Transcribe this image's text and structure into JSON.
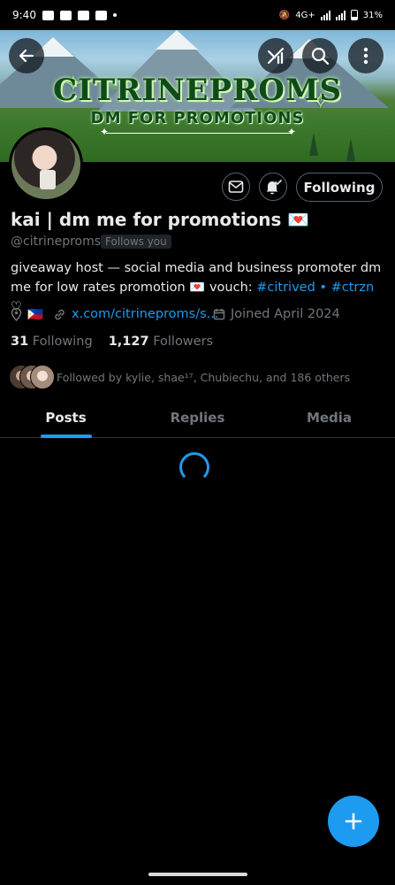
{
  "status_bar": {
    "time": "9:40",
    "network": "4G+",
    "battery": "31%"
  },
  "banner": {
    "title": "CITRINEPROMS",
    "subtitle": "DM FOR PROMOTIONS"
  },
  "profile": {
    "name": "kai | dm me for promotions 💌",
    "handle": "@citrineproms",
    "follows_you": "Follows you",
    "bio_text": "giveaway host — social media and business promoter dm me for low rates promotion 💌 vouch: ",
    "bio_tag1": "#citrived",
    "bio_sep": " • ",
    "bio_tag2": "#ctrzn",
    "bio_end": " ♡",
    "flag": "🇵🇭",
    "link": "x.com/citrineproms/s...",
    "joined": "Joined April 2024",
    "following_count": "31",
    "following_label": "Following",
    "followers_count": "1,127",
    "followers_label": "Followers",
    "followed_by": "Followed by kylie, shae¹⁷, Chubiechu, and 186 others"
  },
  "actions": {
    "follow_label": "Following"
  },
  "tabs": [
    {
      "label": "Posts"
    },
    {
      "label": "Replies"
    },
    {
      "label": "Media"
    }
  ],
  "colors": {
    "accent": "#1d9bf0",
    "background": "#000000"
  }
}
